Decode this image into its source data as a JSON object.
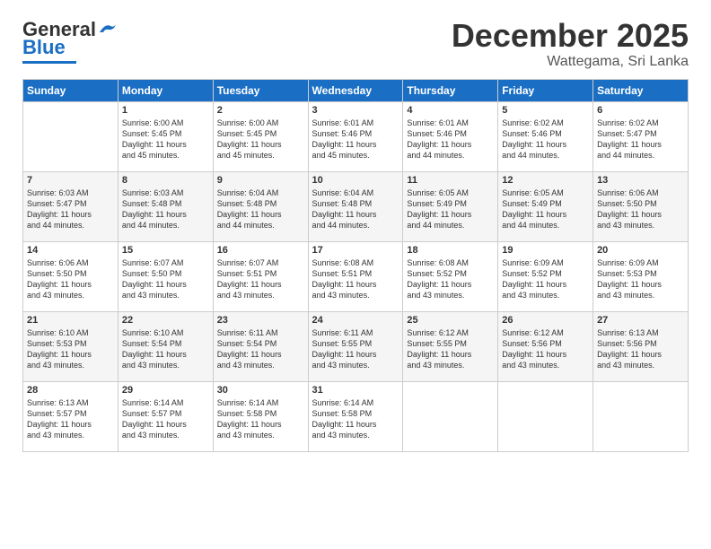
{
  "header": {
    "logo_general": "General",
    "logo_blue": "Blue",
    "month_title": "December 2025",
    "location": "Wattegama, Sri Lanka"
  },
  "calendar": {
    "days_of_week": [
      "Sunday",
      "Monday",
      "Tuesday",
      "Wednesday",
      "Thursday",
      "Friday",
      "Saturday"
    ],
    "weeks": [
      [
        {
          "day": "",
          "info": ""
        },
        {
          "day": "1",
          "info": "Sunrise: 6:00 AM\nSunset: 5:45 PM\nDaylight: 11 hours\nand 45 minutes."
        },
        {
          "day": "2",
          "info": "Sunrise: 6:00 AM\nSunset: 5:45 PM\nDaylight: 11 hours\nand 45 minutes."
        },
        {
          "day": "3",
          "info": "Sunrise: 6:01 AM\nSunset: 5:46 PM\nDaylight: 11 hours\nand 45 minutes."
        },
        {
          "day": "4",
          "info": "Sunrise: 6:01 AM\nSunset: 5:46 PM\nDaylight: 11 hours\nand 44 minutes."
        },
        {
          "day": "5",
          "info": "Sunrise: 6:02 AM\nSunset: 5:46 PM\nDaylight: 11 hours\nand 44 minutes."
        },
        {
          "day": "6",
          "info": "Sunrise: 6:02 AM\nSunset: 5:47 PM\nDaylight: 11 hours\nand 44 minutes."
        }
      ],
      [
        {
          "day": "7",
          "info": "Sunrise: 6:03 AM\nSunset: 5:47 PM\nDaylight: 11 hours\nand 44 minutes."
        },
        {
          "day": "8",
          "info": "Sunrise: 6:03 AM\nSunset: 5:48 PM\nDaylight: 11 hours\nand 44 minutes."
        },
        {
          "day": "9",
          "info": "Sunrise: 6:04 AM\nSunset: 5:48 PM\nDaylight: 11 hours\nand 44 minutes."
        },
        {
          "day": "10",
          "info": "Sunrise: 6:04 AM\nSunset: 5:48 PM\nDaylight: 11 hours\nand 44 minutes."
        },
        {
          "day": "11",
          "info": "Sunrise: 6:05 AM\nSunset: 5:49 PM\nDaylight: 11 hours\nand 44 minutes."
        },
        {
          "day": "12",
          "info": "Sunrise: 6:05 AM\nSunset: 5:49 PM\nDaylight: 11 hours\nand 44 minutes."
        },
        {
          "day": "13",
          "info": "Sunrise: 6:06 AM\nSunset: 5:50 PM\nDaylight: 11 hours\nand 43 minutes."
        }
      ],
      [
        {
          "day": "14",
          "info": "Sunrise: 6:06 AM\nSunset: 5:50 PM\nDaylight: 11 hours\nand 43 minutes."
        },
        {
          "day": "15",
          "info": "Sunrise: 6:07 AM\nSunset: 5:50 PM\nDaylight: 11 hours\nand 43 minutes."
        },
        {
          "day": "16",
          "info": "Sunrise: 6:07 AM\nSunset: 5:51 PM\nDaylight: 11 hours\nand 43 minutes."
        },
        {
          "day": "17",
          "info": "Sunrise: 6:08 AM\nSunset: 5:51 PM\nDaylight: 11 hours\nand 43 minutes."
        },
        {
          "day": "18",
          "info": "Sunrise: 6:08 AM\nSunset: 5:52 PM\nDaylight: 11 hours\nand 43 minutes."
        },
        {
          "day": "19",
          "info": "Sunrise: 6:09 AM\nSunset: 5:52 PM\nDaylight: 11 hours\nand 43 minutes."
        },
        {
          "day": "20",
          "info": "Sunrise: 6:09 AM\nSunset: 5:53 PM\nDaylight: 11 hours\nand 43 minutes."
        }
      ],
      [
        {
          "day": "21",
          "info": "Sunrise: 6:10 AM\nSunset: 5:53 PM\nDaylight: 11 hours\nand 43 minutes."
        },
        {
          "day": "22",
          "info": "Sunrise: 6:10 AM\nSunset: 5:54 PM\nDaylight: 11 hours\nand 43 minutes."
        },
        {
          "day": "23",
          "info": "Sunrise: 6:11 AM\nSunset: 5:54 PM\nDaylight: 11 hours\nand 43 minutes."
        },
        {
          "day": "24",
          "info": "Sunrise: 6:11 AM\nSunset: 5:55 PM\nDaylight: 11 hours\nand 43 minutes."
        },
        {
          "day": "25",
          "info": "Sunrise: 6:12 AM\nSunset: 5:55 PM\nDaylight: 11 hours\nand 43 minutes."
        },
        {
          "day": "26",
          "info": "Sunrise: 6:12 AM\nSunset: 5:56 PM\nDaylight: 11 hours\nand 43 minutes."
        },
        {
          "day": "27",
          "info": "Sunrise: 6:13 AM\nSunset: 5:56 PM\nDaylight: 11 hours\nand 43 minutes."
        }
      ],
      [
        {
          "day": "28",
          "info": "Sunrise: 6:13 AM\nSunset: 5:57 PM\nDaylight: 11 hours\nand 43 minutes."
        },
        {
          "day": "29",
          "info": "Sunrise: 6:14 AM\nSunset: 5:57 PM\nDaylight: 11 hours\nand 43 minutes."
        },
        {
          "day": "30",
          "info": "Sunrise: 6:14 AM\nSunset: 5:58 PM\nDaylight: 11 hours\nand 43 minutes."
        },
        {
          "day": "31",
          "info": "Sunrise: 6:14 AM\nSunset: 5:58 PM\nDaylight: 11 hours\nand 43 minutes."
        },
        {
          "day": "",
          "info": ""
        },
        {
          "day": "",
          "info": ""
        },
        {
          "day": "",
          "info": ""
        }
      ]
    ]
  }
}
